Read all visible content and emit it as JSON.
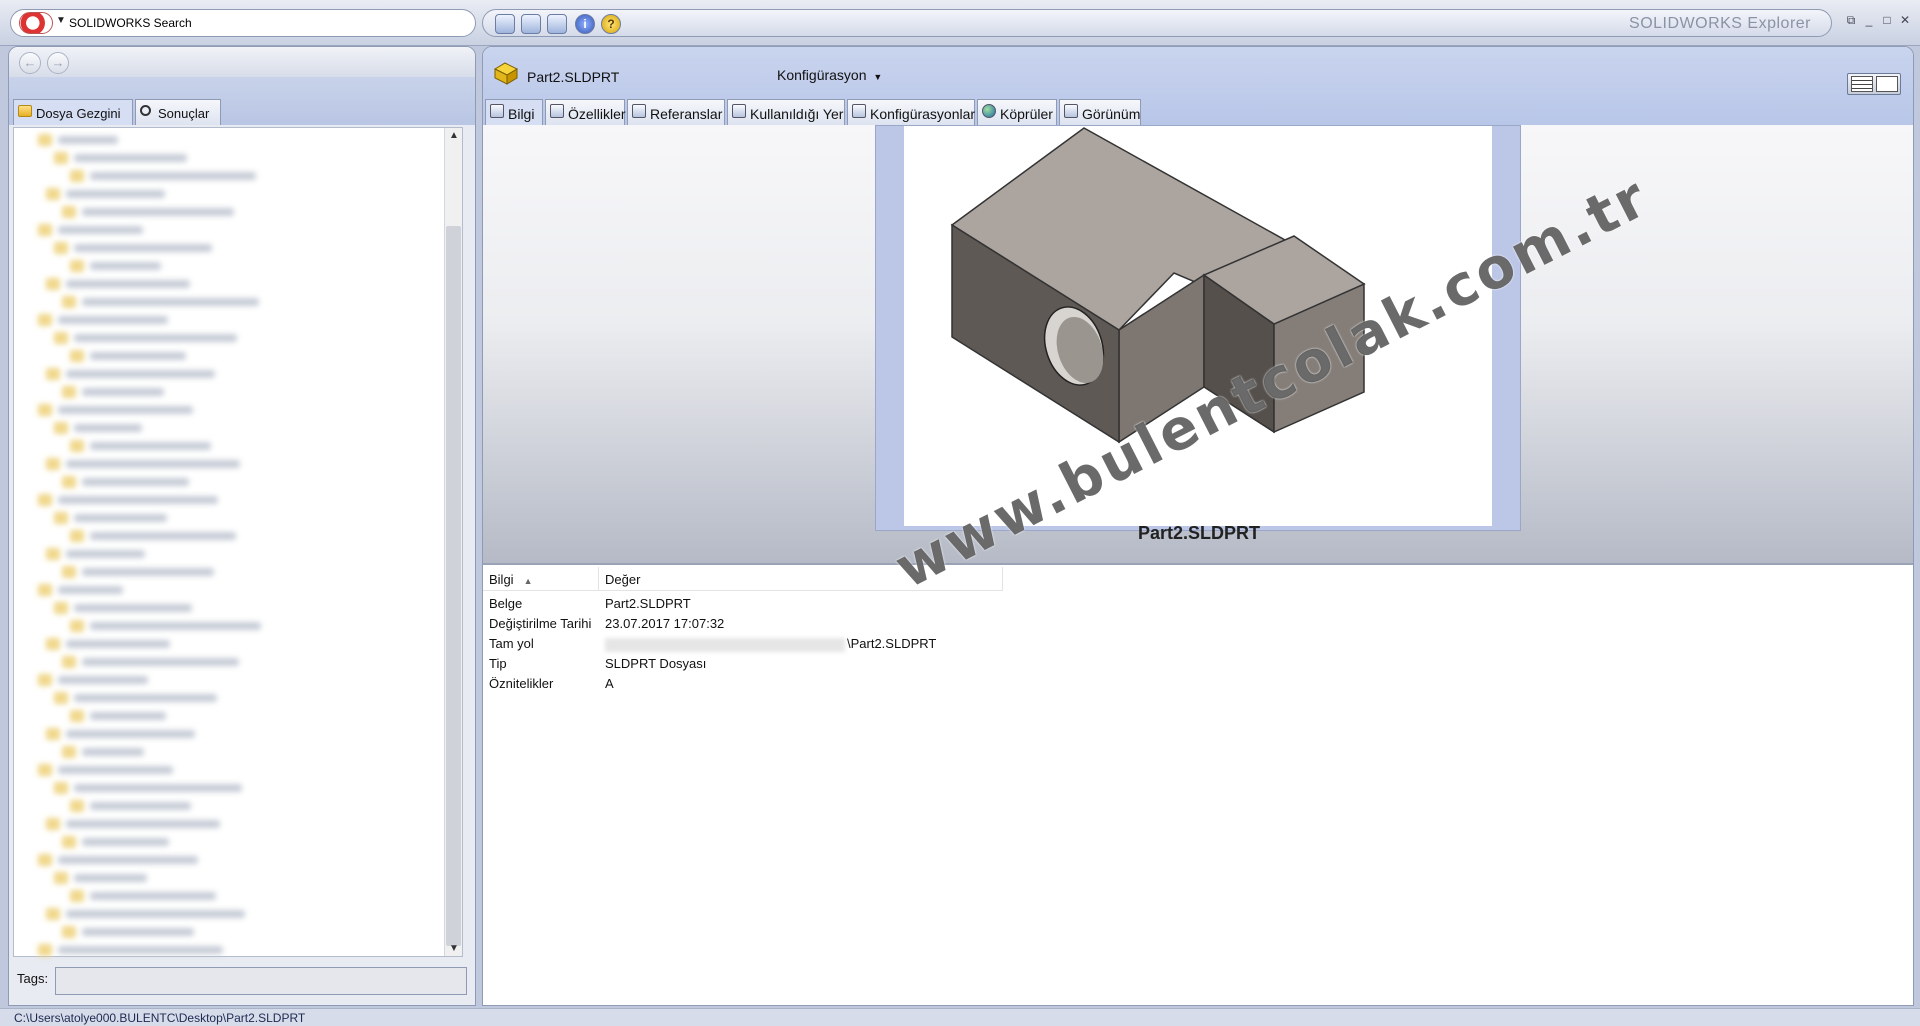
{
  "search": {
    "label": "SOLIDWORKS Search"
  },
  "app": {
    "title": "SOLIDWORKS Explorer"
  },
  "left": {
    "tabs": [
      {
        "label": "Dosya Gezgini"
      },
      {
        "label": "Sonuçlar"
      }
    ],
    "tags_label": "Tags:"
  },
  "document": {
    "filename": "Part2.SLDPRT",
    "config_label": "Konfigürasyon",
    "preview_caption": "Part2.SLDPRT",
    "tabs": [
      {
        "label": "Bilgi"
      },
      {
        "label": "Özellikler"
      },
      {
        "label": "Referanslar"
      },
      {
        "label": "Kullanıldığı Yer"
      },
      {
        "label": "Konfigürasyonlar"
      },
      {
        "label": "Köprüler"
      },
      {
        "label": "Görünüm"
      }
    ]
  },
  "properties": {
    "columns": [
      "Bilgi",
      "Değer"
    ],
    "rows": [
      {
        "key": "Belge",
        "value": "Part2.SLDPRT"
      },
      {
        "key": "Değiştirilme Tarihi",
        "value": "23.07.2017 17:07:32"
      },
      {
        "key": "Tam yol",
        "value": "\\Part2.SLDPRT"
      },
      {
        "key": "Tip",
        "value": "SLDPRT Dosyası"
      },
      {
        "key": "Öznitelikler",
        "value": "A"
      }
    ]
  },
  "status": {
    "path": "C:\\Users\\atolye000.BULENTC\\Desktop\\Part2.SLDPRT"
  },
  "watermark": "www.bulentcolak.com.tr"
}
